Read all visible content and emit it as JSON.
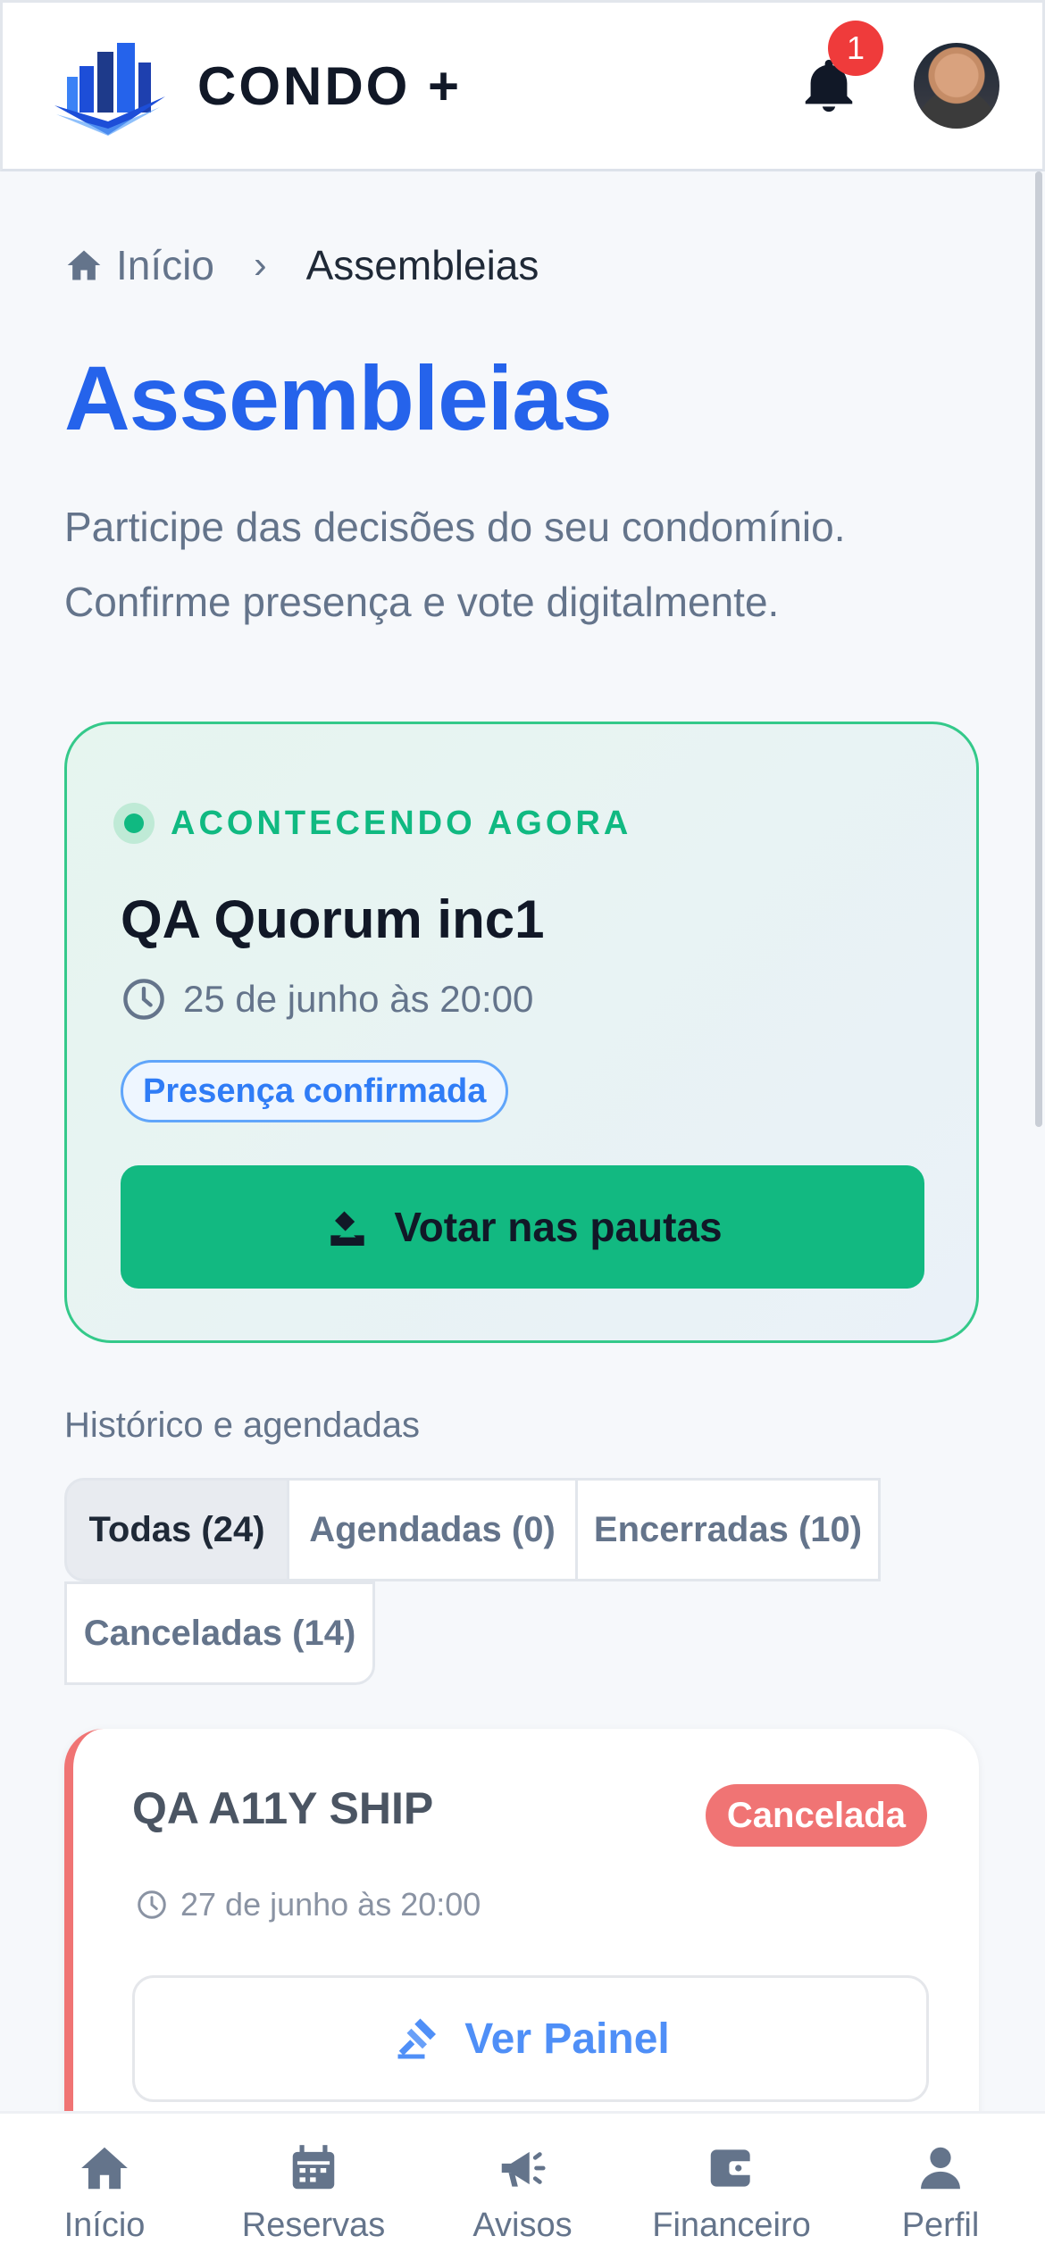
{
  "header": {
    "brand": "CONDO +",
    "notification_count": "1"
  },
  "breadcrumb": {
    "home_label": "Início",
    "current_label": "Assembleias"
  },
  "page": {
    "title": "Assembleias",
    "subtitle": "Participe das decisões do seu condomínio. Confirme presença e vote digitalmente."
  },
  "live": {
    "status_label": "ACONTECENDO AGORA",
    "title": "QA Quorum inc1",
    "datetime": "25 de junho às 20:00",
    "presence_label": "Presença confirmada",
    "vote_label": "Votar nas pautas"
  },
  "history": {
    "section_label": "Histórico e agendadas",
    "tabs": [
      {
        "label": "Todas (24)",
        "active": true
      },
      {
        "label": "Agendadas (0)",
        "active": false
      },
      {
        "label": "Encerradas (10)",
        "active": false
      },
      {
        "label": "Canceladas (14)",
        "active": false
      }
    ],
    "items": [
      {
        "title": "QA A11Y SHIP",
        "status": "Cancelada",
        "datetime": "27 de junho às 20:00",
        "action_label": "Ver Painel"
      }
    ]
  },
  "bottom_nav": [
    {
      "label": "Início",
      "icon": "home-icon"
    },
    {
      "label": "Reservas",
      "icon": "calendar-icon"
    },
    {
      "label": "Avisos",
      "icon": "megaphone-icon"
    },
    {
      "label": "Financeiro",
      "icon": "wallet-icon"
    },
    {
      "label": "Perfil",
      "icon": "user-icon"
    }
  ],
  "colors": {
    "accent_blue": "#2563eb",
    "live_green": "#10b981",
    "cancel_red": "#f07474",
    "badge_red": "#ef3b3b"
  }
}
